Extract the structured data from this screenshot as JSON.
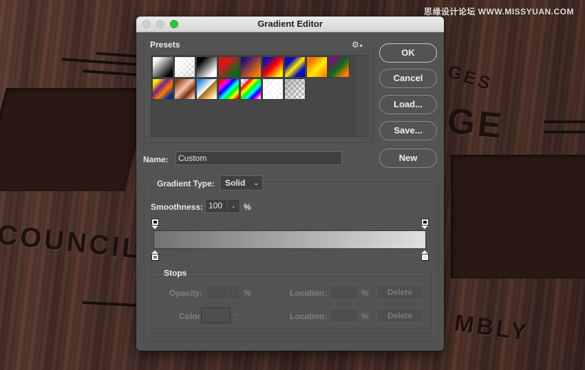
{
  "background": {
    "engraved_words": [
      "COUNCIL",
      "GE",
      "GES",
      "MBLY"
    ],
    "watermark": "思缘设计论坛 WWW.MISSYUAN.COM"
  },
  "dialog": {
    "title": "Gradient Editor",
    "window_controls": [
      "close",
      "minimize",
      "zoom"
    ],
    "presets": {
      "label": "Presets",
      "settings_icon": "gear-icon",
      "swatches": [
        {
          "name": "Foreground to Background",
          "css": "linear-gradient(135deg,#ffffff 15%,#000000 85%)"
        },
        {
          "name": "Foreground to Transparent",
          "css": "checker-white"
        },
        {
          "name": "Black, White",
          "css": "linear-gradient(135deg,#000000 20%,#ffffff 80%)"
        },
        {
          "name": "Red, Green",
          "css": "linear-gradient(135deg,#e0141c 30%,#0b6a1e 80%)"
        },
        {
          "name": "Violet, Orange",
          "css": "linear-gradient(135deg,#2a0d7a 15%,#ff7c00 85%)"
        },
        {
          "name": "Blue, Red, Yellow",
          "css": "linear-gradient(135deg,#0b0fb5 15%,#ff0000 50%,#ffee00 85%)"
        },
        {
          "name": "Blue, Yellow, Blue",
          "css": "linear-gradient(135deg,#0b0fb5 25%,#ffee00 50%,#0b0fb5 75%)"
        },
        {
          "name": "Orange, Yellow, Orange",
          "css": "linear-gradient(135deg,#ff7400 20%,#ffee00 55%,#ff8a00 90%)"
        },
        {
          "name": "Violet, Green, Orange",
          "css": "linear-gradient(135deg,#7b0f79 15%,#0b6a1e 50%,#ff7c00 85%)"
        },
        {
          "name": "Yellow, Violet, Orange, Blue",
          "css": "linear-gradient(135deg,#ffe400 15%,#7a1f86 38%,#ff7c00 60%,#0b2b8c 85%)"
        },
        {
          "name": "Copper",
          "css": "linear-gradient(135deg,#8a3b12 10%,#f0c5a8 45%,#7a3210 70%,#f5dccd 95%)"
        },
        {
          "name": "Chrome",
          "css": "linear-gradient(135deg,#2a86d6 10%,#ffffff 48%,#a36c14 52%,#f2d18c 80%,#ffffff 95%)"
        },
        {
          "name": "Spectrum",
          "css": "linear-gradient(135deg,#ff0000 10%,#ff00ff 25%,#0000ff 40%,#00ffff 55%,#00ff00 68%,#ffff00 80%,#ff0000 95%)"
        },
        {
          "name": "Transparent Rainbow",
          "css": "linear-gradient(135deg,rgba(255,255,255,0) 15%,#ff0000 25%,#ffff00 38%,#00ff00 50%,#00ffff 62%,#0000ff 75%,#ff00ff 85%,rgba(255,255,255,0) 95%)"
        },
        {
          "name": "Transparent Stripes",
          "css": "checker-white-stripes"
        },
        {
          "name": "Neutral Density",
          "css": "checker-gray"
        }
      ]
    },
    "buttons": {
      "ok": "OK",
      "cancel": "Cancel",
      "load": "Load...",
      "save": "Save...",
      "new": "New"
    },
    "name": {
      "label": "Name:",
      "value": "Custom"
    },
    "gradient_type": {
      "label": "Gradient Type:",
      "value": "Solid"
    },
    "smoothness": {
      "label": "Smoothness:",
      "value": "100",
      "unit": "%"
    },
    "gradient_bar": {
      "start_color": "#727272",
      "end_color": "#e0e0e0",
      "opacity_stops": [
        {
          "location_pct": 0,
          "color": "#000000"
        },
        {
          "location_pct": 100,
          "color": "#000000"
        }
      ],
      "color_stops": [
        {
          "location_pct": 0,
          "color": "#787878"
        },
        {
          "location_pct": 100,
          "color": "#e0e0e0"
        }
      ]
    },
    "stops": {
      "label": "Stops",
      "opacity_label": "Opacity:",
      "opacity_value": "",
      "opacity_unit": "%",
      "color_label": "Color:",
      "location_label_1": "Location:",
      "location_value_1": "",
      "location_unit_1": "%",
      "location_label_2": "Location:",
      "location_value_2": "",
      "location_unit_2": "%",
      "delete_label_1": "Delete",
      "delete_label_2": "Delete"
    }
  }
}
